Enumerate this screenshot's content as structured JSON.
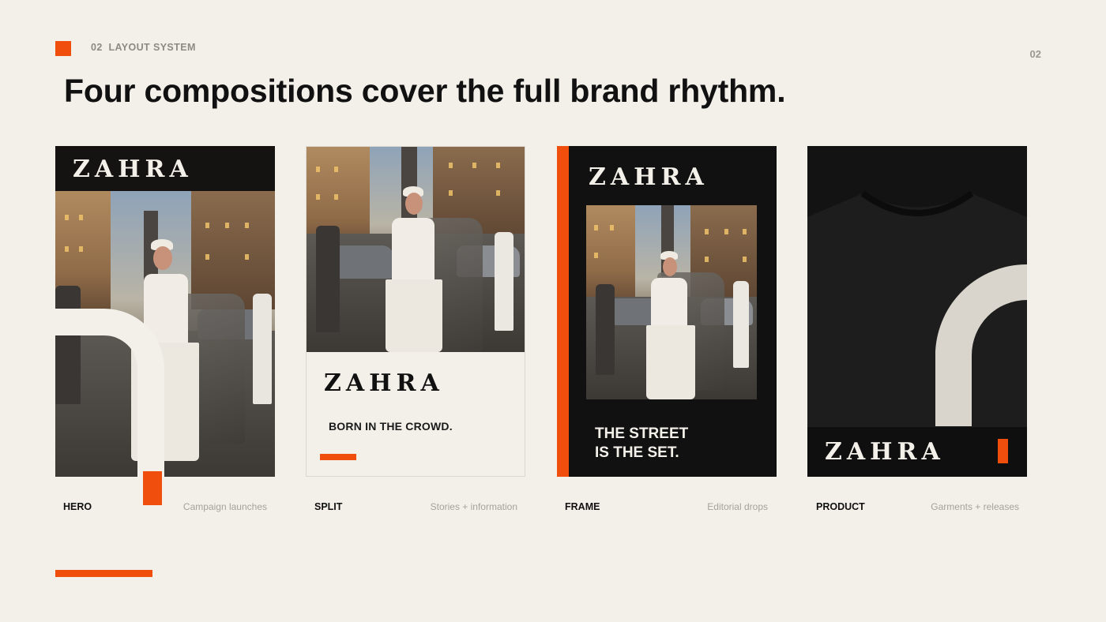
{
  "header": {
    "kicker": "02  LAYOUT SYSTEM",
    "page_number": "02",
    "headline": "Four compositions cover the full brand rhythm."
  },
  "brand": {
    "logo_text": "ZAHRA",
    "accent_color": "#f04e0c",
    "dark_color": "#111111",
    "paper_color": "#f3f0e9"
  },
  "cards": [
    {
      "name": "HERO",
      "description": "Campaign launches"
    },
    {
      "name": "SPLIT",
      "description": "Stories + information",
      "tagline": "BORN IN THE CROWD."
    },
    {
      "name": "FRAME",
      "description": "Editorial drops",
      "tagline_line1": "THE STREET",
      "tagline_line2": "IS THE SET."
    },
    {
      "name": "PRODUCT",
      "description": "Garments + releases"
    }
  ]
}
